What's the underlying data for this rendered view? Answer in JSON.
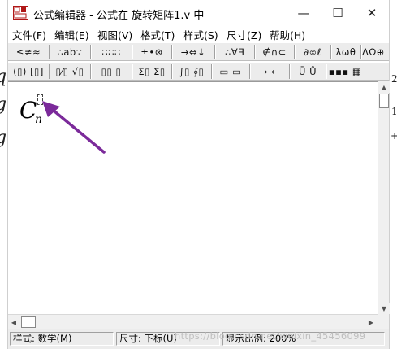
{
  "window": {
    "title": "公式编辑器 - 公式在 旋转矩阵1.v 中",
    "controls": {
      "minimize": "—",
      "maximize": "☐",
      "close": "✕"
    }
  },
  "background_doc": {
    "left_glyphs": [
      "q",
      "g",
      "g"
    ],
    "right_glyphs": [
      "2",
      "1",
      "+"
    ]
  },
  "menu": [
    "文件(F)",
    "编辑(E)",
    "视图(V)",
    "格式(T)",
    "样式(S)",
    "尺寸(Z)",
    "帮助(H)"
  ],
  "toolbar_row1": [
    "≤≠≈",
    "∴ab∵",
    "∷∷∷",
    "±•⊗",
    "→⇔↓",
    "∴∀∃",
    "∉∩⊂",
    "∂∞ℓ",
    "λωθ",
    "ΛΩ⊕"
  ],
  "toolbar_row2": [
    "(▯) [▯]",
    "▯⁄▯ √▯",
    "▯▯ ▯",
    "Σ▯ Σ▯",
    "∫▯ ∮▯",
    "▭ ▭",
    "→ ←",
    "Ū Ů",
    "▪▪▪ ▦"
  ],
  "formula": {
    "base": "C",
    "subscript": "n"
  },
  "status": {
    "style": "样式: 数学(M)",
    "size": "尺寸: 下标(U)",
    "zoom": "显示比例: 200%"
  },
  "watermark": "https://blog.csdn.net/weixin_45456099",
  "colors": {
    "annotation_arrow": "#7b2a9a",
    "toolbar_bg": "#ececec"
  }
}
